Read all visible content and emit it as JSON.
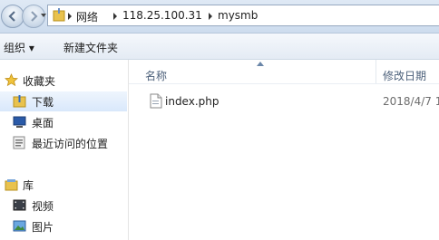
{
  "address": {
    "crumbs": [
      "网络",
      "118.25.100.31",
      "mysmb"
    ]
  },
  "toolbar": {
    "organize_label": "组织 ▾",
    "new_folder_label": "新建文件夹"
  },
  "sidebar": {
    "favorites_label": "收藏夹",
    "favorites": [
      "下载",
      "桌面",
      "最近访问的位置"
    ],
    "library_label": "库",
    "libraries": [
      "视频",
      "图片"
    ]
  },
  "columns": {
    "name": "名称",
    "modified": "修改日期"
  },
  "files": [
    {
      "name": "index.php",
      "modified": "2018/4/7 1"
    }
  ],
  "colors": {
    "accent": "#3d6fb4",
    "selection": "#d9e8fb",
    "header_text": "#4c607a"
  }
}
